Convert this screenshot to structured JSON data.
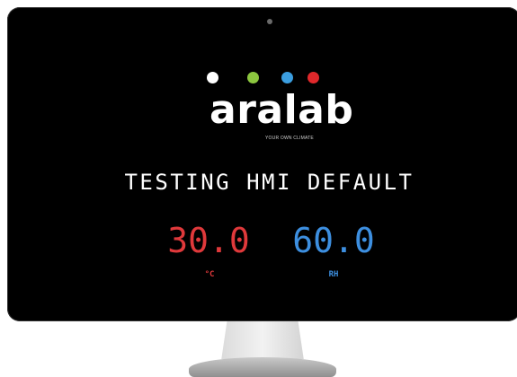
{
  "brand": {
    "name": "aralab",
    "tagline": "YOUR OWN CLIMATE",
    "dot_colors": [
      "#ffffff",
      "#8cc63f",
      "#3b9ee0",
      "#e0282b"
    ]
  },
  "screen": {
    "title": "TESTING HMI DEFAULT",
    "temperature": {
      "value": "30.0",
      "unit": "°C",
      "color": "#e0393b"
    },
    "humidity": {
      "value": "60.0",
      "unit": "RH",
      "color": "#3d8fe0"
    }
  },
  "icons": [
    "camera-icon"
  ]
}
